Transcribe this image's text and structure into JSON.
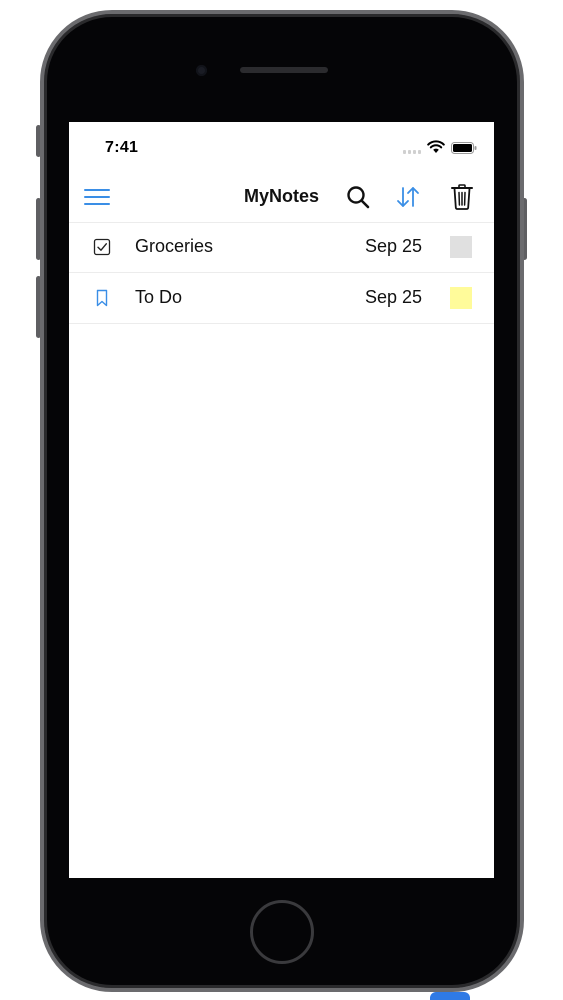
{
  "status_bar": {
    "time": "7:41"
  },
  "nav": {
    "title": "MyNotes",
    "menu_icon": "hamburger-menu-icon",
    "search_icon": "search-icon",
    "sort_icon": "sort-arrows-icon",
    "delete_icon": "trash-icon",
    "accent_color": "#3a8ee6"
  },
  "notes": [
    {
      "title": "Groceries",
      "date": "Sep 25",
      "icon": "checkbox-icon",
      "color": "#e0e0e0"
    },
    {
      "title": "To Do",
      "date": "Sep 25",
      "icon": "bookmark-icon",
      "color": "#fffb9a"
    }
  ]
}
